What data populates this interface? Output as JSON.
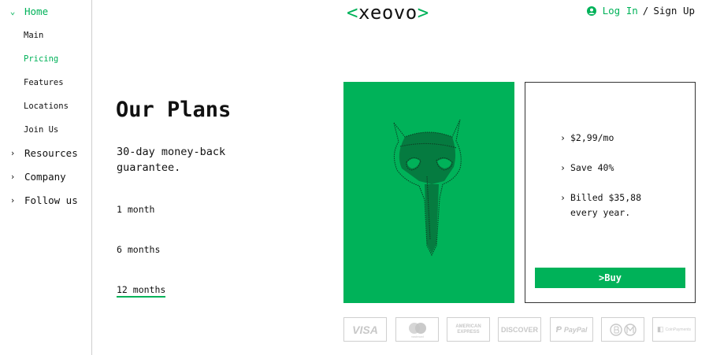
{
  "brand": {
    "logo_open": "<",
    "logo_text": "xeovo",
    "logo_close": ">"
  },
  "header": {
    "login_label": "Log In",
    "separator": "/",
    "signup_label": "Sign Up"
  },
  "sidebar": {
    "home": {
      "chevron": "⌄",
      "label": "Home"
    },
    "sub_items": [
      {
        "label": "Main"
      },
      {
        "label": "Pricing"
      },
      {
        "label": "Features"
      },
      {
        "label": "Locations"
      },
      {
        "label": "Join Us"
      }
    ],
    "sections": [
      {
        "chevron": "›",
        "label": "Resources"
      },
      {
        "chevron": "›",
        "label": "Company"
      },
      {
        "chevron": "›",
        "label": "Follow us"
      }
    ]
  },
  "plans": {
    "title": "Our Plans",
    "subtitle": "30-day money-back guarantee.",
    "options": [
      {
        "label": "1 month"
      },
      {
        "label": "6 months"
      },
      {
        "label": "12 months",
        "selected": true
      }
    ]
  },
  "hero_image": {
    "icon": "plague-doctor-mask",
    "background": "#00b259"
  },
  "plan_card": {
    "features": [
      {
        "arrow": "›",
        "text": "$2,99/mo"
      },
      {
        "arrow": "›",
        "text": "Save 40%"
      },
      {
        "arrow": "›",
        "text": "Billed $35,88 every year."
      }
    ],
    "buy_label": ">Buy"
  },
  "payment_methods": [
    {
      "label": "VISA"
    },
    {
      "label": "mastercard"
    },
    {
      "label": "AMERICAN EXPRESS"
    },
    {
      "label": "DISCOVER"
    },
    {
      "label": "PayPal"
    },
    {
      "label": "crypto"
    },
    {
      "label": "CoinPayments"
    }
  ],
  "colors": {
    "accent": "#00b259",
    "text": "#111111",
    "border": "#cfcfcf"
  }
}
